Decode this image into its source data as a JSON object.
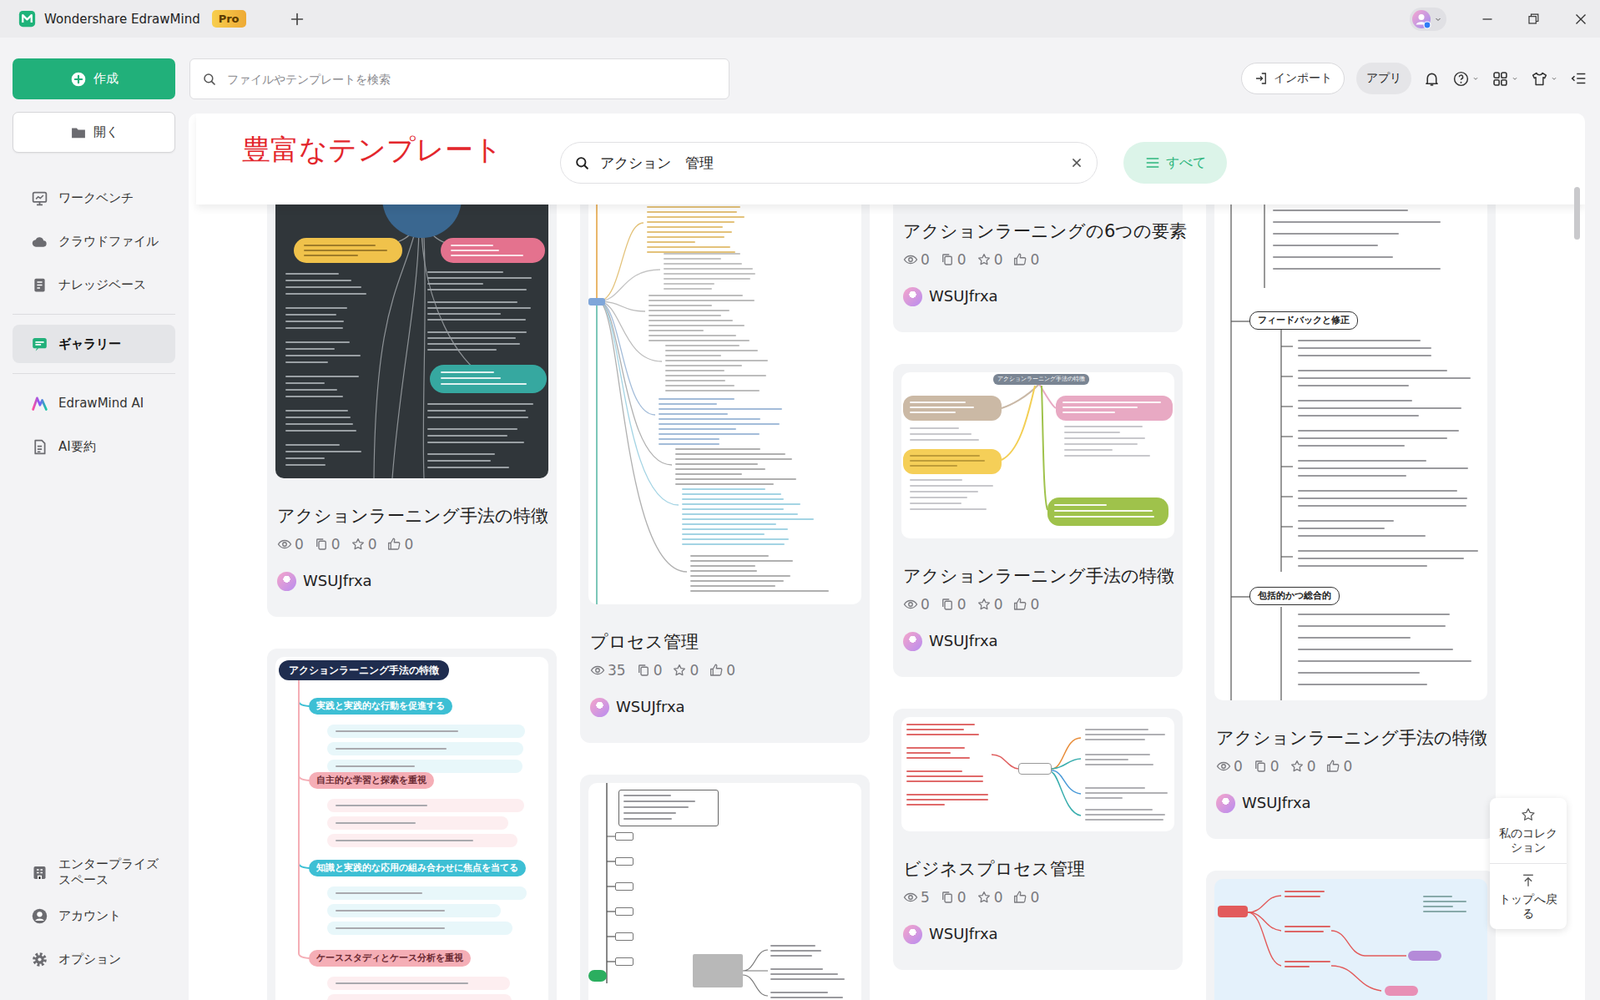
{
  "window": {
    "app_name": "Wondershare EdrawMind",
    "badge": "Pro"
  },
  "sidebar": {
    "create": {
      "label": "作成"
    },
    "open": {
      "label": "開く"
    },
    "groups": [
      [
        {
          "label": "ワークベンチ",
          "selected": false
        },
        {
          "label": "クラウドファイル",
          "selected": false
        },
        {
          "label": "ナレッジベース",
          "selected": false
        }
      ],
      [
        {
          "label": "ギャラリー",
          "selected": true
        }
      ],
      [
        {
          "label": "EdrawMind AI",
          "selected": false
        },
        {
          "label": "AI要約",
          "selected": false
        }
      ]
    ],
    "bottom": [
      {
        "label": "エンタープライズスペース",
        "selected": false
      },
      {
        "label": "アカウント",
        "selected": false
      },
      {
        "label": "オプション",
        "selected": false
      }
    ]
  },
  "toolbar": {
    "search": {
      "placeholder": "ファイルやテンプレートを検索"
    },
    "import": "インポート",
    "apps": {
      "label": "アプリ",
      "selected": true
    }
  },
  "gallery": {
    "heading": "豊富なテンプレート",
    "search": {
      "value": "アクション　管理"
    },
    "filter": "すべて",
    "columns": [
      [
        {
          "thumb": {
            "kind": "dark"
          },
          "title": "アクションラーニング手法の特徴",
          "stats": {
            "views": "0",
            "copies": "0",
            "stars": "0",
            "likes": "0"
          },
          "author": "WSUJfrxa"
        },
        {
          "thumb": {
            "kind": "labeled",
            "labels": [
              {
                "text": "アクションラーニング手法の特徴",
                "color": "#1f2d4f"
              },
              {
                "text": "実践と実践的な行動を促進する",
                "color": "#3dbfd4"
              },
              {
                "text": "自主的な学習と探索を重視",
                "color": "#f5aeb6"
              },
              {
                "text": "知識と実践的な応用の組み合わせに焦点を当てる",
                "color": "#3dbfd4"
              },
              {
                "text": "ケーススタディとケース分析を重視",
                "color": "#f5aeb6"
              }
            ]
          }
        }
      ],
      [
        {
          "thumb": {
            "kind": "tree"
          },
          "title": "プロセス管理",
          "stats": {
            "views": "35",
            "copies": "0",
            "stars": "0",
            "likes": "0"
          },
          "author": "WSUJfrxa"
        },
        {
          "thumb": {
            "kind": "branches"
          }
        }
      ],
      [
        {
          "thumb": {
            "kind": "hidden"
          },
          "title": "アクションラーニングの6つの要素",
          "stats": {
            "views": "0",
            "copies": "0",
            "stars": "0",
            "likes": "0"
          },
          "author": "WSUJfrxa"
        },
        {
          "thumb": {
            "kind": "colorful",
            "labels": [
              {
                "text": "アクションラーニング手法の特徴"
              }
            ]
          },
          "title": "アクションラーニング手法の特徴",
          "stats": {
            "views": "0",
            "copies": "0",
            "stars": "0",
            "likes": "0"
          },
          "author": "WSUJfrxa"
        },
        {
          "thumb": {
            "kind": "network"
          },
          "title": "ビジネスプロセス管理",
          "stats": {
            "views": "5",
            "copies": "0",
            "stars": "0",
            "likes": "0"
          },
          "author": "WSUJfrxa"
        },
        {
          "thumb": {
            "kind": "banner"
          }
        }
      ],
      [
        {
          "thumb": {
            "kind": "outline",
            "labels": [
              {
                "text": "フィードバックと修正"
              },
              {
                "text": "包括的かつ総合的"
              }
            ]
          },
          "title": "アクションラーニング手法の特徴",
          "stats": {
            "views": "0",
            "copies": "0",
            "stars": "0",
            "likes": "0"
          },
          "author": "WSUJfrxa"
        },
        {
          "thumb": {
            "kind": "sky"
          }
        }
      ]
    ]
  },
  "float": {
    "collection": "私のコレクション",
    "back_to_top": "トップへ戻る"
  }
}
